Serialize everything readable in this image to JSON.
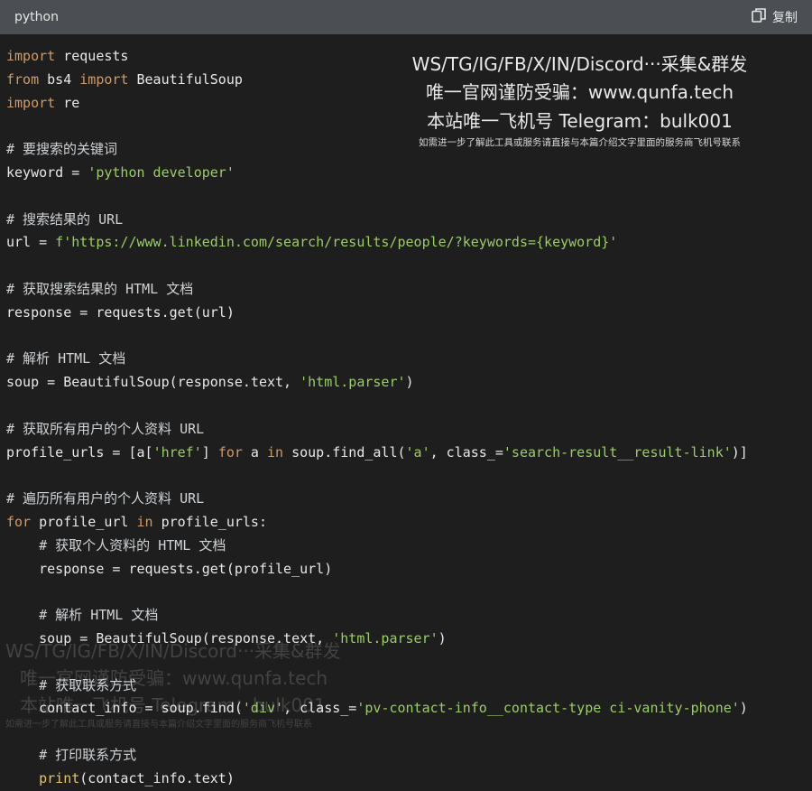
{
  "header": {
    "language": "python",
    "copy_label": "复制",
    "copy_icon": "copy-icon"
  },
  "code": {
    "lines": [
      [
        {
          "t": "kw",
          "v": "import"
        },
        {
          "t": "p",
          "v": " requests"
        }
      ],
      [
        {
          "t": "kw",
          "v": "from"
        },
        {
          "t": "p",
          "v": " bs4 "
        },
        {
          "t": "kw",
          "v": "import"
        },
        {
          "t": "p",
          "v": " BeautifulSoup"
        }
      ],
      [
        {
          "t": "kw",
          "v": "import"
        },
        {
          "t": "p",
          "v": " re"
        }
      ],
      [],
      [
        {
          "t": "cm",
          "v": "# 要搜索的关键词"
        }
      ],
      [
        {
          "t": "p",
          "v": "keyword = "
        },
        {
          "t": "str",
          "v": "'python developer'"
        }
      ],
      [],
      [
        {
          "t": "cm",
          "v": "# 搜索结果的 URL"
        }
      ],
      [
        {
          "t": "p",
          "v": "url = "
        },
        {
          "t": "str",
          "v": "f'https://www.linkedin.com/search/results/people/?keywords={keyword}'"
        }
      ],
      [],
      [
        {
          "t": "cm",
          "v": "# 获取搜索结果的 HTML 文档"
        }
      ],
      [
        {
          "t": "p",
          "v": "response = requests.get(url)"
        }
      ],
      [],
      [
        {
          "t": "cm",
          "v": "# 解析 HTML 文档"
        }
      ],
      [
        {
          "t": "p",
          "v": "soup = BeautifulSoup(response.text, "
        },
        {
          "t": "str",
          "v": "'html.parser'"
        },
        {
          "t": "p",
          "v": ")"
        }
      ],
      [],
      [
        {
          "t": "cm",
          "v": "# 获取所有用户的个人资料 URL"
        }
      ],
      [
        {
          "t": "p",
          "v": "profile_urls = [a["
        },
        {
          "t": "str",
          "v": "'href'"
        },
        {
          "t": "p",
          "v": "] "
        },
        {
          "t": "kw",
          "v": "for"
        },
        {
          "t": "p",
          "v": " a "
        },
        {
          "t": "kw",
          "v": "in"
        },
        {
          "t": "p",
          "v": " soup.find_all("
        },
        {
          "t": "str",
          "v": "'a'"
        },
        {
          "t": "p",
          "v": ", class_="
        },
        {
          "t": "str",
          "v": "'search-result__result-link'"
        },
        {
          "t": "p",
          "v": ")]"
        }
      ],
      [],
      [
        {
          "t": "cm",
          "v": "# 遍历所有用户的个人资料 URL"
        }
      ],
      [
        {
          "t": "kw",
          "v": "for"
        },
        {
          "t": "p",
          "v": " profile_url "
        },
        {
          "t": "kw",
          "v": "in"
        },
        {
          "t": "p",
          "v": " profile_urls:"
        }
      ],
      [
        {
          "t": "p",
          "v": "    "
        },
        {
          "t": "cm",
          "v": "# 获取个人资料的 HTML 文档"
        }
      ],
      [
        {
          "t": "p",
          "v": "    response = requests.get(profile_url)"
        }
      ],
      [],
      [
        {
          "t": "p",
          "v": "    "
        },
        {
          "t": "cm",
          "v": "# 解析 HTML 文档"
        }
      ],
      [
        {
          "t": "p",
          "v": "    soup = BeautifulSoup(response.text, "
        },
        {
          "t": "str",
          "v": "'html.parser'"
        },
        {
          "t": "p",
          "v": ")"
        }
      ],
      [],
      [
        {
          "t": "p",
          "v": "    "
        },
        {
          "t": "cm",
          "v": "# 获取联系方式"
        }
      ],
      [
        {
          "t": "p",
          "v": "    contact_info = soup.find("
        },
        {
          "t": "str",
          "v": "'div'"
        },
        {
          "t": "p",
          "v": ", class_="
        },
        {
          "t": "str",
          "v": "'pv-contact-info__contact-type ci-vanity-phone'"
        },
        {
          "t": "p",
          "v": ")"
        }
      ],
      [],
      [
        {
          "t": "p",
          "v": "    "
        },
        {
          "t": "cm",
          "v": "# 打印联系方式"
        }
      ],
      [
        {
          "t": "p",
          "v": "    "
        },
        {
          "t": "fn",
          "v": "print"
        },
        {
          "t": "p",
          "v": "(contact_info.text)"
        }
      ]
    ]
  },
  "watermark": {
    "line1": "WS/TG/IG/FB/X/IN/Discord···采集&群发",
    "line2": "唯一官网谨防受骗：www.qunfa.tech",
    "line3": "本站唯一飞机号 Telegram：bulk001",
    "line4": "如需进一步了解此工具或服务请直接与本篇介绍文字里面的服务商飞机号联系"
  },
  "watermark_ghost": {
    "line1": "WS/TG/IG/FB/X/IN/Discord···采集&群发",
    "line2": "唯一官网谨防受骗：www.qunfa.tech",
    "line3": "本站唯一飞机号 Telegram：bulk001",
    "line4": "如需进一步了解此工具或服务请直接与本篇介绍文字里面的服务商飞机号联系"
  }
}
